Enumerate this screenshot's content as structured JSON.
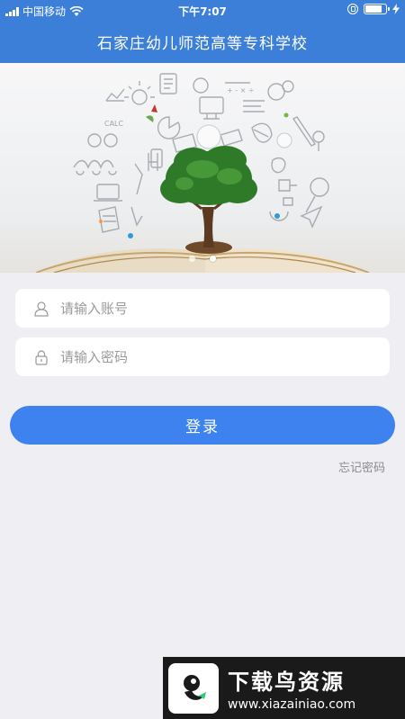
{
  "status_bar": {
    "carrier": "中国移动",
    "time": "下午7:07"
  },
  "nav": {
    "title": "石家庄幼儿师范高等专科学校"
  },
  "banner": {
    "slide_count": 2,
    "active_slide": 2
  },
  "form": {
    "account_placeholder": "请输入账号",
    "account_value": "",
    "password_placeholder": "请输入密码",
    "password_value": "",
    "login_label": "登录",
    "forgot_label": "忘记密码"
  },
  "watermark": {
    "title": "下载鸟资源",
    "url": "www.xiazainiao.com"
  },
  "colors": {
    "header": "#3b7fd9",
    "button": "#3d82ee",
    "background": "#eeeef3"
  }
}
